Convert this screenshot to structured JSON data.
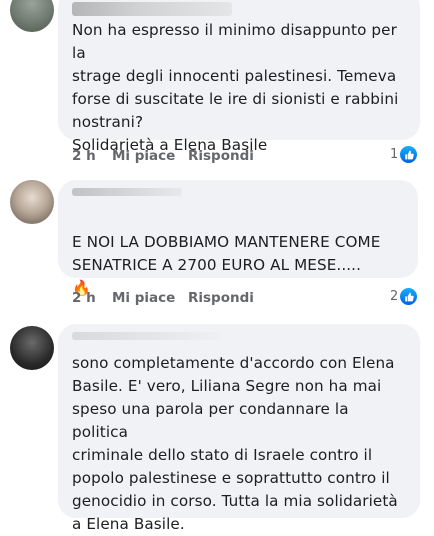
{
  "comments": [
    {
      "text": "Non ha espresso il minimo disappunto per la\nstrage degli innocenti palestinesi.  Temeva\nforse di suscitate le ire di sionisti e rabbini\nnostrani?\nSolidarietà a Elena Basile",
      "time": "2 h",
      "like_label": "Mi piace",
      "reply_label": "Rispondi",
      "reactions": "1"
    },
    {
      "text": "E NOI LA DOBBIAMO MANTENERE COME\nSENATRICE A 2700 EURO AL MESE.....",
      "emojis_line1": "🔥",
      "emojis_line2": "😫🔥😫",
      "time": "2 h",
      "like_label": "Mi piace",
      "reply_label": "Rispondi",
      "reactions": "2"
    },
    {
      "text": "sono completamente d'accordo con Elena\nBasile. E' vero, Liliana Segre non ha mai\nspeso una parola per condannare la politica\ncriminale dello stato di Israele contro il\npopolo palestinese e soprattutto contro il\ngenocidio in corso. Tutta la mia solidarietà\na Elena Basile."
    }
  ],
  "icons": {
    "reaction": "like-thumb-icon"
  },
  "colors": {
    "bubble": "#f0f2f5",
    "meta": "#65676b",
    "like_blue": "#0866ff"
  }
}
